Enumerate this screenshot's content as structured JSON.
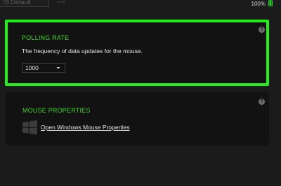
{
  "topbar": {
    "profile_value": "78 Default",
    "more_icon": "more-horizontal-icon",
    "battery_text": "100%",
    "battery_icon": "battery-charging-icon"
  },
  "polling": {
    "title": "POLLING RATE",
    "description": "The frequency of data updates for the mouse.",
    "selected_value": "1000",
    "help_icon": "help-icon",
    "highlight_color": "#22ee1a"
  },
  "mouse_properties": {
    "title": "MOUSE PROPERTIES",
    "link_label": "Open Windows Mouse Properties",
    "icon": "windows-logo-icon",
    "help_icon": "help-icon"
  },
  "colors": {
    "accent": "#44d62c",
    "background": "#1b1b1b",
    "card": "#121212"
  }
}
